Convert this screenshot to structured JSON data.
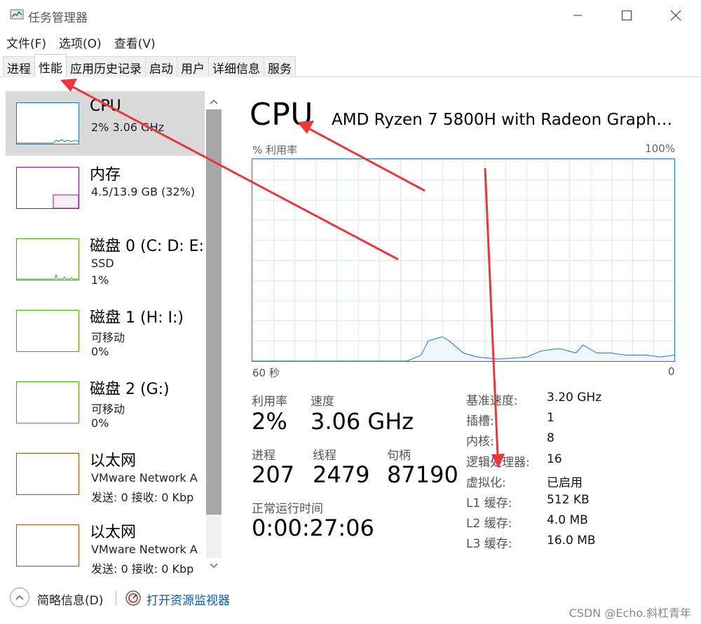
{
  "window": {
    "title": "任务管理器"
  },
  "menu": [
    "文件(F)",
    "选项(O)",
    "查看(V)"
  ],
  "tabs": [
    "进程",
    "性能",
    "应用历史记录",
    "启动",
    "用户",
    "详细信息",
    "服务"
  ],
  "active_tab": "性能",
  "sidebar": [
    {
      "name": "CPU",
      "sub1": "2%  3.06 GHz",
      "sub2": "",
      "color": "#117dbb",
      "selected": true
    },
    {
      "name": "内存",
      "sub1": "4.5/13.9 GB (32%)",
      "sub2": "",
      "color": "#8b12ae",
      "selected": false
    },
    {
      "name": "磁盘 0 (C: D: E:",
      "sub1": "SSD",
      "sub2": "1%",
      "color": "#4da60c",
      "selected": false
    },
    {
      "name": "磁盘 1 (H: I:)",
      "sub1": "可移动",
      "sub2": "0%",
      "color": "#4da60c",
      "selected": false
    },
    {
      "name": "磁盘 2 (G:)",
      "sub1": "可移动",
      "sub2": "0%",
      "color": "#4da60c",
      "selected": false
    },
    {
      "name": "以太网",
      "sub1": "VMware Network A",
      "sub2": "发送: 0 接收: 0 Kbp",
      "color": "#a74f01",
      "selected": false
    },
    {
      "name": "以太网",
      "sub1": "VMware Network A",
      "sub2": "发送: 0 接收: 0 Kbp",
      "color": "#a74f01",
      "selected": false
    }
  ],
  "main": {
    "title": "CPU",
    "model": "AMD Ryzen 7 5800H with Radeon Graphi...",
    "util_label": "% 利用率",
    "util_max": "100%",
    "axis_left": "60 秒",
    "axis_right": "0",
    "stats": {
      "utilization_label": "利用率",
      "utilization_value": "2%",
      "speed_label": "速度",
      "speed_value": "3.06 GHz",
      "processes_label": "进程",
      "processes_value": "207",
      "threads_label": "线程",
      "threads_value": "2479",
      "handles_label": "句柄",
      "handles_value": "87190",
      "uptime_label": "正常运行时间",
      "uptime_value": "0:00:27:06"
    },
    "specs": [
      {
        "label": "基准速度:",
        "value": "3.20 GHz"
      },
      {
        "label": "插槽:",
        "value": "1"
      },
      {
        "label": "内核:",
        "value": "8"
      },
      {
        "label": "逻辑处理器:",
        "value": "16"
      },
      {
        "label": "虚拟化:",
        "value": "已启用"
      },
      {
        "label": "L1 缓存:",
        "value": "512 KB"
      },
      {
        "label": "L2 缓存:",
        "value": "4.0 MB"
      },
      {
        "label": "L3 缓存:",
        "value": "16.0 MB"
      }
    ]
  },
  "footer": {
    "fewer_details": "简略信息(D)",
    "resource_monitor": "打开资源监视器",
    "watermark": "CSDN @Echo.斜杠青年"
  },
  "colors": {
    "cpu": "#117dbb",
    "memory": "#8b12ae",
    "disk": "#4da60c",
    "ethernet": "#a74f01",
    "arrow": "#e8383d"
  },
  "chart_data": {
    "type": "area",
    "ylim": [
      0,
      100
    ],
    "xlim": [
      60,
      0
    ],
    "x": [
      60,
      38,
      36,
      35,
      33,
      32,
      30,
      28,
      25,
      21,
      19,
      17,
      16,
      15,
      14,
      13,
      11,
      9,
      7,
      4,
      2,
      0
    ],
    "values": [
      0,
      0,
      3,
      10,
      12,
      10,
      4,
      2,
      1,
      2,
      5,
      6,
      6,
      5,
      4,
      8,
      4,
      4,
      3,
      3,
      2,
      3
    ]
  }
}
